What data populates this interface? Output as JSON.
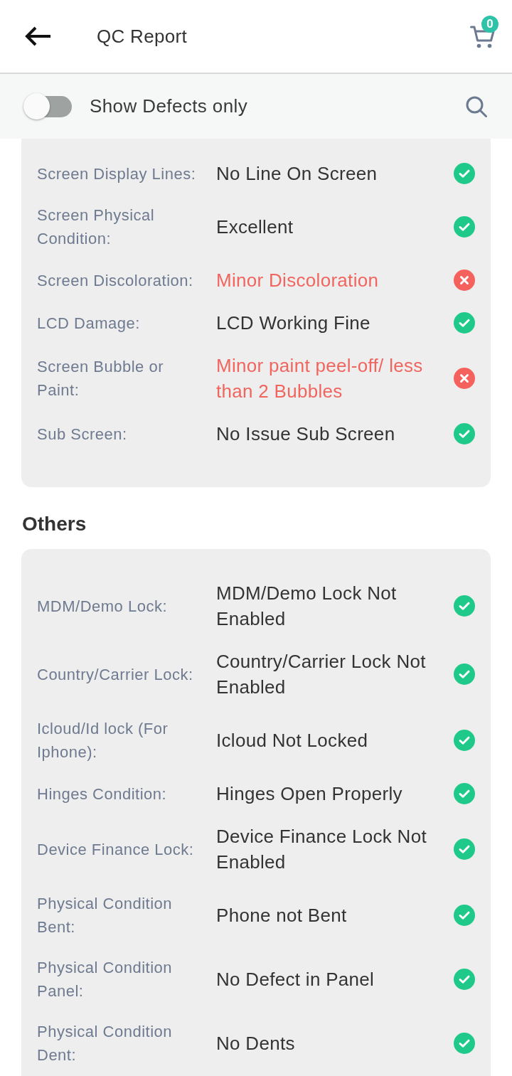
{
  "header": {
    "title": "QC Report",
    "cart_count": "0"
  },
  "filter_bar": {
    "toggle": {
      "label": "Show Defects only",
      "on": false
    }
  },
  "sections": [
    {
      "rows": [
        {
          "label": "Screen Display Lines:",
          "value": "No Line On Screen",
          "passed": true
        },
        {
          "label": "Screen Physical Condition:",
          "value": "Excellent",
          "passed": true
        },
        {
          "label": "Screen Discoloration:",
          "value": "Minor Discoloration",
          "passed": false
        },
        {
          "label": "LCD Damage:",
          "value": "LCD Working Fine",
          "passed": true
        },
        {
          "label": "Screen Bubble or Paint:",
          "value": "Minor paint peel-off/ less than 2 Bubbles",
          "passed": false
        },
        {
          "label": "Sub Screen:",
          "value": "No Issue Sub Screen",
          "passed": true
        }
      ]
    },
    {
      "title": "Others",
      "rows": [
        {
          "label": "MDM/Demo Lock:",
          "value": "MDM/Demo Lock Not Enabled",
          "passed": true
        },
        {
          "label": "Country/Carrier Lock:",
          "value": "Country/Carrier Lock Not Enabled",
          "passed": true
        },
        {
          "label": "Icloud/Id lock (For Iphone):",
          "value": "Icloud Not Locked",
          "passed": true
        },
        {
          "label": "Hinges Condition:",
          "value": "Hinges Open Properly",
          "passed": true
        },
        {
          "label": "Device Finance Lock:",
          "value": "Device Finance Lock Not Enabled",
          "passed": true
        },
        {
          "label": "Physical Condition Bent:",
          "value": "Phone not Bent",
          "passed": true
        },
        {
          "label": "Physical Condition Panel:",
          "value": "No Defect in Panel",
          "passed": true
        },
        {
          "label": "Physical Condition Dent:",
          "value": "No Dents",
          "passed": true
        }
      ]
    }
  ]
}
